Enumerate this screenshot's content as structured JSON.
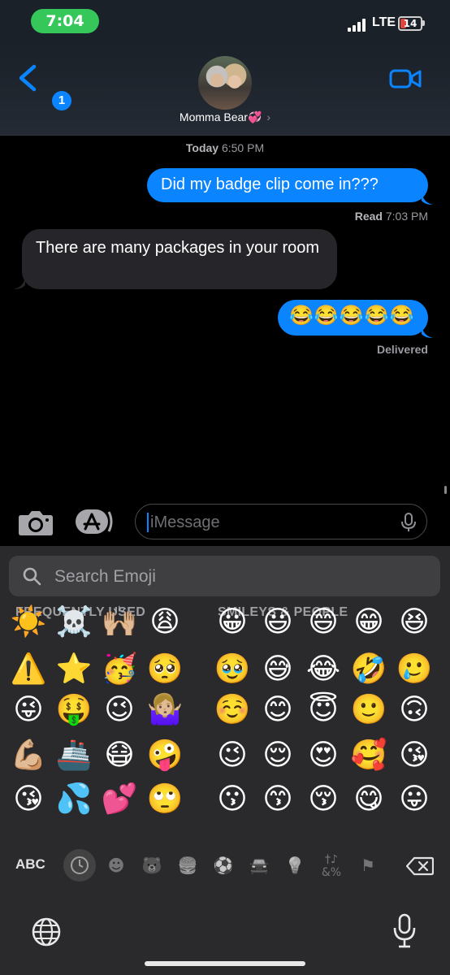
{
  "status": {
    "time": "7:04",
    "network": "LTE",
    "battery_level": "14"
  },
  "header": {
    "unread_count": "1",
    "contact_name": "Momma Bear",
    "contact_emoji": "💞"
  },
  "thread": {
    "date_label": "Today",
    "date_time": "6:50 PM",
    "messages": [
      {
        "direction": "out",
        "text": "Did my badge clip come in???"
      },
      {
        "direction": "in",
        "text": "There are many packages in your room"
      },
      {
        "direction": "out",
        "text": "😂😂😂😂😂"
      }
    ],
    "read_label": "Read",
    "read_time": "7:03 PM",
    "delivered_label": "Delivered"
  },
  "composer": {
    "placeholder": "iMessage"
  },
  "keyboard": {
    "search_placeholder": "Search Emoji",
    "sections": [
      {
        "title": "FREQUENTLY USED",
        "emojis": [
          "☀️",
          "⚠️",
          "😜",
          "💪🏼",
          "😘",
          "☠️",
          "⭐",
          "🤑",
          "🚢",
          "💦",
          "🙌🏼",
          "🥳",
          "😉",
          "😷",
          "💕",
          "😩",
          "🥺",
          "🤷🏼‍♀️",
          "🤪",
          "🙄"
        ]
      },
      {
        "title": "SMILEYS & PEOPLE",
        "emojis": [
          "😀",
          "🥹",
          "☺️",
          "😉",
          "😗",
          "😃",
          "😅",
          "😊",
          "😌",
          "😙",
          "😄",
          "😂",
          "😇",
          "😍",
          "😚",
          "😁",
          "🤣",
          "🙂",
          "🥰",
          "😋",
          "😆",
          "🥲",
          "🙃",
          "😘",
          "😛"
        ]
      }
    ],
    "abc_label": "ABC",
    "categories": [
      "recent-clock",
      "smileys",
      "animals",
      "food",
      "activity",
      "travel",
      "objects",
      "symbols",
      "flags"
    ]
  }
}
